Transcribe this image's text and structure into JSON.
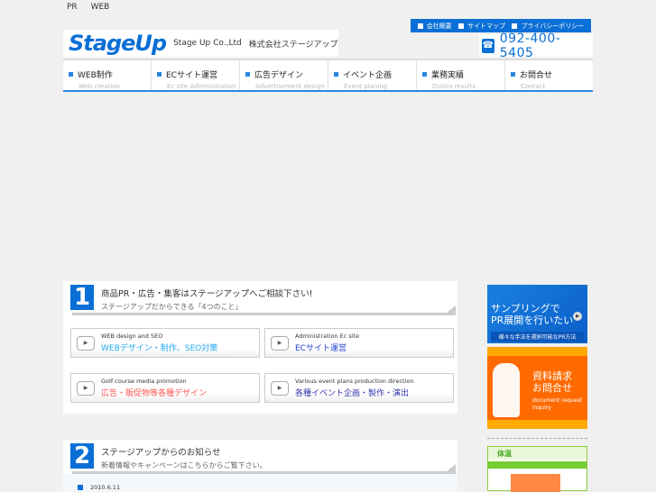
{
  "top_links": [
    "PR",
    "WEB"
  ],
  "utility_nav": [
    "会社概要",
    "サイトマップ",
    "プライバシーポリシー"
  ],
  "logo": {
    "mark": "StageUp",
    "company_en": "Stage Up Co.,Ltd",
    "company_jp": "株式会社ステージアップ"
  },
  "phone": "092-400-5405",
  "nav": [
    {
      "jp": "WEB制作",
      "en": "Web creation"
    },
    {
      "jp": "ECサイト運営",
      "en": "Ec site Administration"
    },
    {
      "jp": "広告デザイン",
      "en": "Advertisement design"
    },
    {
      "jp": "イベント企画",
      "en": "Event planing"
    },
    {
      "jp": "業務実績",
      "en": "Duties results"
    },
    {
      "jp": "お問合せ",
      "en": "Contact"
    }
  ],
  "section1": {
    "number": "1",
    "title": "商品PR・広告・集客はステージアップへご相談下さい!",
    "subtitle": "ステージアップだからできる「4つのこと」",
    "cards": [
      {
        "en": "WEB design and SEO",
        "jp": "WEBデザイン・制作、SEO対策",
        "color": "#22aaee"
      },
      {
        "en": "Administration Ec site",
        "jp": "ECサイト運営",
        "color": "#2244cc"
      },
      {
        "en": "Golf course media promotion",
        "jp": "広告・販促物等各種デザイン",
        "color": "#ff5555"
      },
      {
        "en": "Various event plans  production  direction",
        "jp": "各種イベント企画・製作・演出",
        "color": "#3333aa"
      }
    ]
  },
  "section2": {
    "number": "2",
    "title": "ステージアップからのお知らせ",
    "subtitle": "新着情報やキャンペーンはこちらからご覧下さい。",
    "news": [
      {
        "date": "2010.6.11"
      }
    ]
  },
  "sidebar": {
    "banner1": {
      "line1": "サンプリングで",
      "line2": "PR展開を行いたい",
      "caption": "様々な手法を選択可能なPR方法"
    },
    "banner2": {
      "line1": "資料請求",
      "line2": "お問合せ",
      "en1": "document request",
      "en2": "inquiry"
    },
    "thumb": {
      "title": "体温"
    }
  }
}
